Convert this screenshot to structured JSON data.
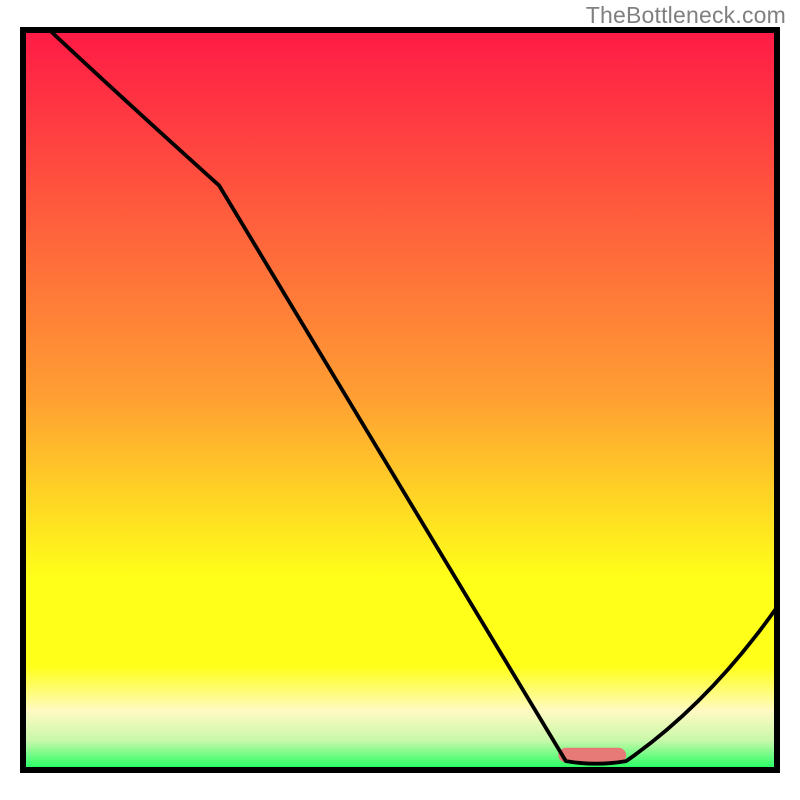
{
  "attribution": "TheBottleneck.com",
  "colors": {
    "red": "#ff1a46",
    "orange": "#ffa033",
    "yellow": "#ffff19",
    "pale_yellow": "#fffac2",
    "green": "#19ff5e",
    "border": "#000000",
    "curve": "#000000",
    "marker": "#e77a77"
  },
  "chart_data": {
    "type": "line",
    "title": "",
    "xlabel": "",
    "ylabel": "",
    "xlim": [
      0,
      100
    ],
    "ylim": [
      0,
      100
    ],
    "x": [
      3.5,
      26,
      72,
      80,
      100
    ],
    "values": [
      100,
      79,
      1.2,
      1.2,
      22
    ],
    "marker": {
      "x_start": 71,
      "x_end": 80,
      "y": 1.0,
      "height": 2.0
    },
    "gradient_stops_y_pct": [
      0,
      50,
      74,
      86,
      92,
      96,
      100
    ],
    "gradient_colors": [
      "#ff1a46",
      "#ffa033",
      "#ffff19",
      "#ffff19",
      "#fffac2",
      "#c9f8aa",
      "#19ff5e"
    ],
    "notes": "V-shaped bottleneck curve overlaid on vertical heat gradient; minimum (optimal) region highlighted by salmon marker near x≈71–80."
  }
}
